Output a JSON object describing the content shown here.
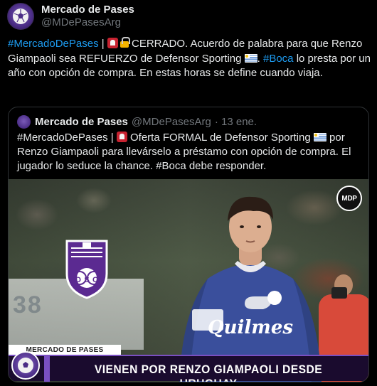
{
  "tweet": {
    "display_name": "Mercado de Pases",
    "handle": "@MDePasesArg",
    "text_hashtag": "#MercadoDePases",
    "text_sep": " | ",
    "text_closed": " CERRADO. Acuerdo de palabra para que Renzo Giampaoli sea REFUERZO de Defensor Sporting ",
    "text_boca": "#Boca",
    "text_rest": " lo presta por un año con opción de compra. En estas horas se define cuando viaja.",
    "icons": [
      "rotating-light-icon",
      "lock-icon",
      "uruguay-flag-icon"
    ]
  },
  "quote": {
    "display_name": "Mercado de Pases",
    "handle": "@MDePasesArg",
    "date": "· 13 ene.",
    "text_part1": "#MercadoDePases | ",
    "text_part2": " Oferta FORMAL de Defensor Sporting ",
    "text_part3": " por Renzo Giampaoli para llevárselo a préstamo con opción de compra. El jugador lo seduce la chance. #Boca debe responder.",
    "media": {
      "badge_text": "MDP",
      "crest_letters": [
        "D",
        "S",
        "C"
      ],
      "sponsor": "Quilmes",
      "banner_label": "MERCADO DE PASES",
      "banner_headline": "VIENEN POR RENZO GIAMPAOLI DESDE URUGUAY"
    }
  },
  "colors": {
    "background": "#000000",
    "text": "#e7e9ea",
    "muted": "#71767b",
    "link": "#1d9bf0",
    "brand_purple": "#7a4fc2"
  }
}
